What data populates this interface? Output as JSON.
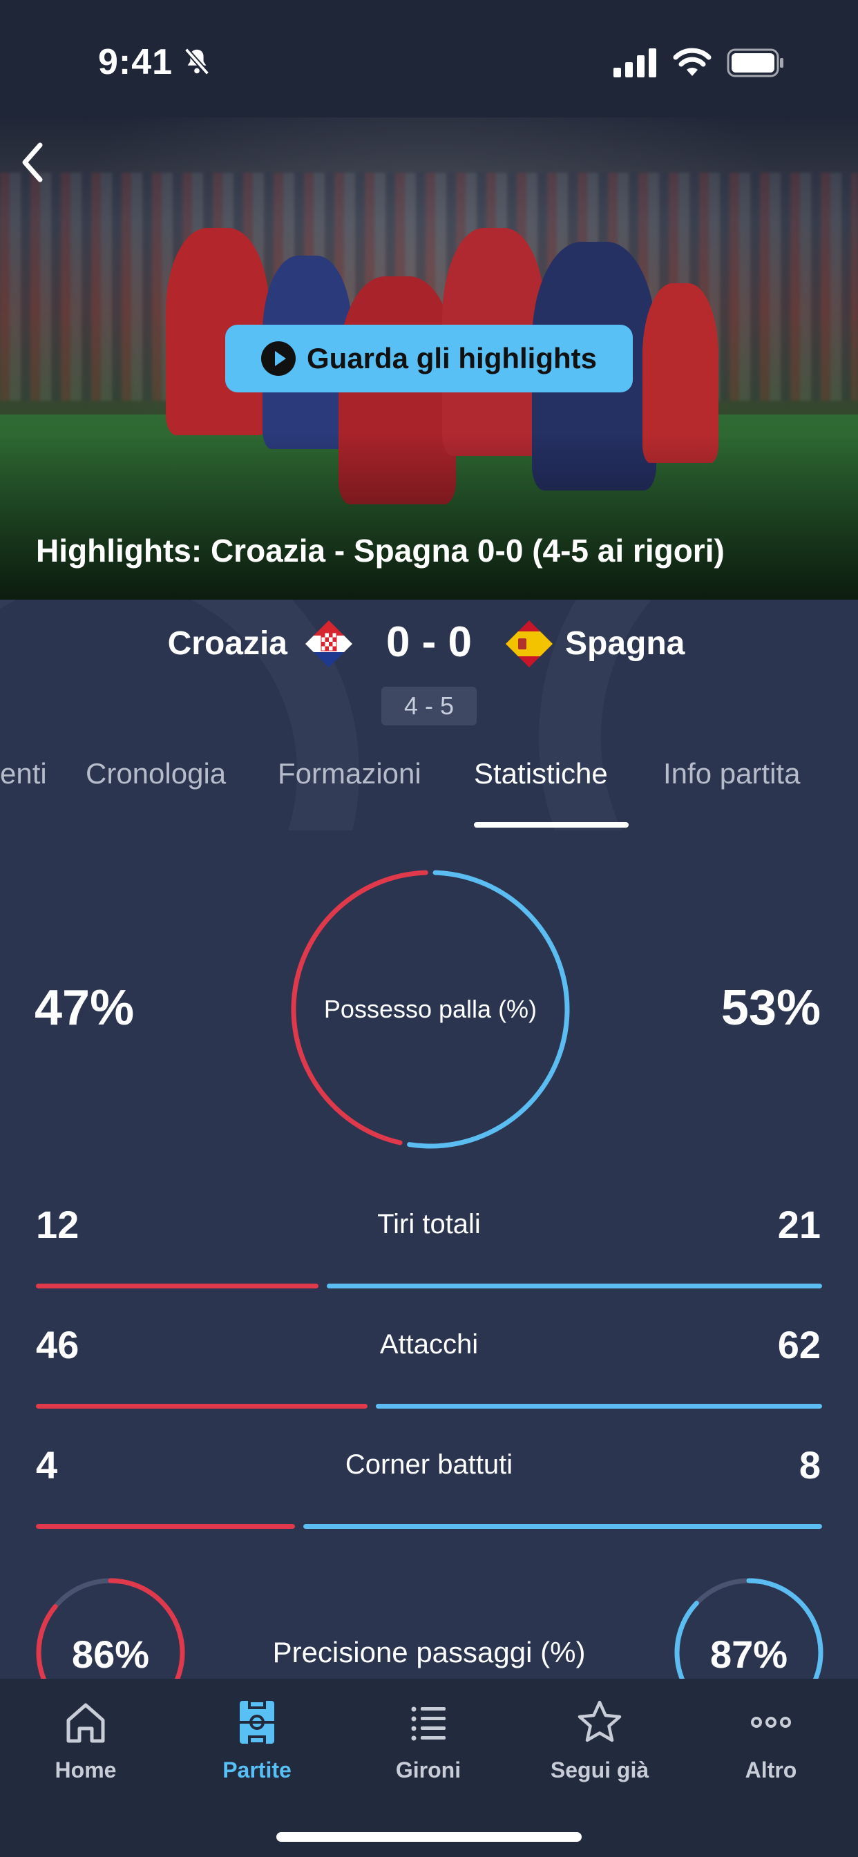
{
  "status_bar": {
    "time": "9:41"
  },
  "hero": {
    "button_label": "Guarda gli highlights",
    "title": "Highlights: Croazia - Spagna 0-0 (4-5 ai rigori)"
  },
  "match": {
    "home_team": "Croazia",
    "away_team": "Spagna",
    "score": "0 - 0",
    "penalties": "4 - 5"
  },
  "tabs": [
    {
      "label": "enti"
    },
    {
      "label": "Cronologia"
    },
    {
      "label": "Formazioni"
    },
    {
      "label": "Statistiche",
      "active": true
    },
    {
      "label": "Info partita"
    }
  ],
  "stats": {
    "possession": {
      "label": "Possesso palla (%)",
      "home": "47%",
      "away": "53%",
      "home_value": 47,
      "away_value": 53
    },
    "rows": [
      {
        "label": "Tiri totali",
        "home": "12",
        "away": "21",
        "home_value": 12,
        "away_value": 21
      },
      {
        "label": "Attacchi",
        "home": "46",
        "away": "62",
        "home_value": 46,
        "away_value": 62
      },
      {
        "label": "Corner battuti",
        "home": "4",
        "away": "8",
        "home_value": 4,
        "away_value": 8
      }
    ],
    "passing": {
      "label": "Precisione passaggi (%)",
      "home": "86%",
      "away": "87%",
      "home_value": 86,
      "away_value": 87
    }
  },
  "colors": {
    "home": "#e0394b",
    "away": "#5bbdf2",
    "accent": "#58c0f5",
    "background": "#2b3550"
  },
  "nav": [
    {
      "label": "Home",
      "icon": "home-icon"
    },
    {
      "label": "Partite",
      "icon": "pitch-icon",
      "active": true
    },
    {
      "label": "Gironi",
      "icon": "list-icon"
    },
    {
      "label": "Segui già",
      "icon": "star-icon"
    },
    {
      "label": "Altro",
      "icon": "more-icon"
    }
  ]
}
